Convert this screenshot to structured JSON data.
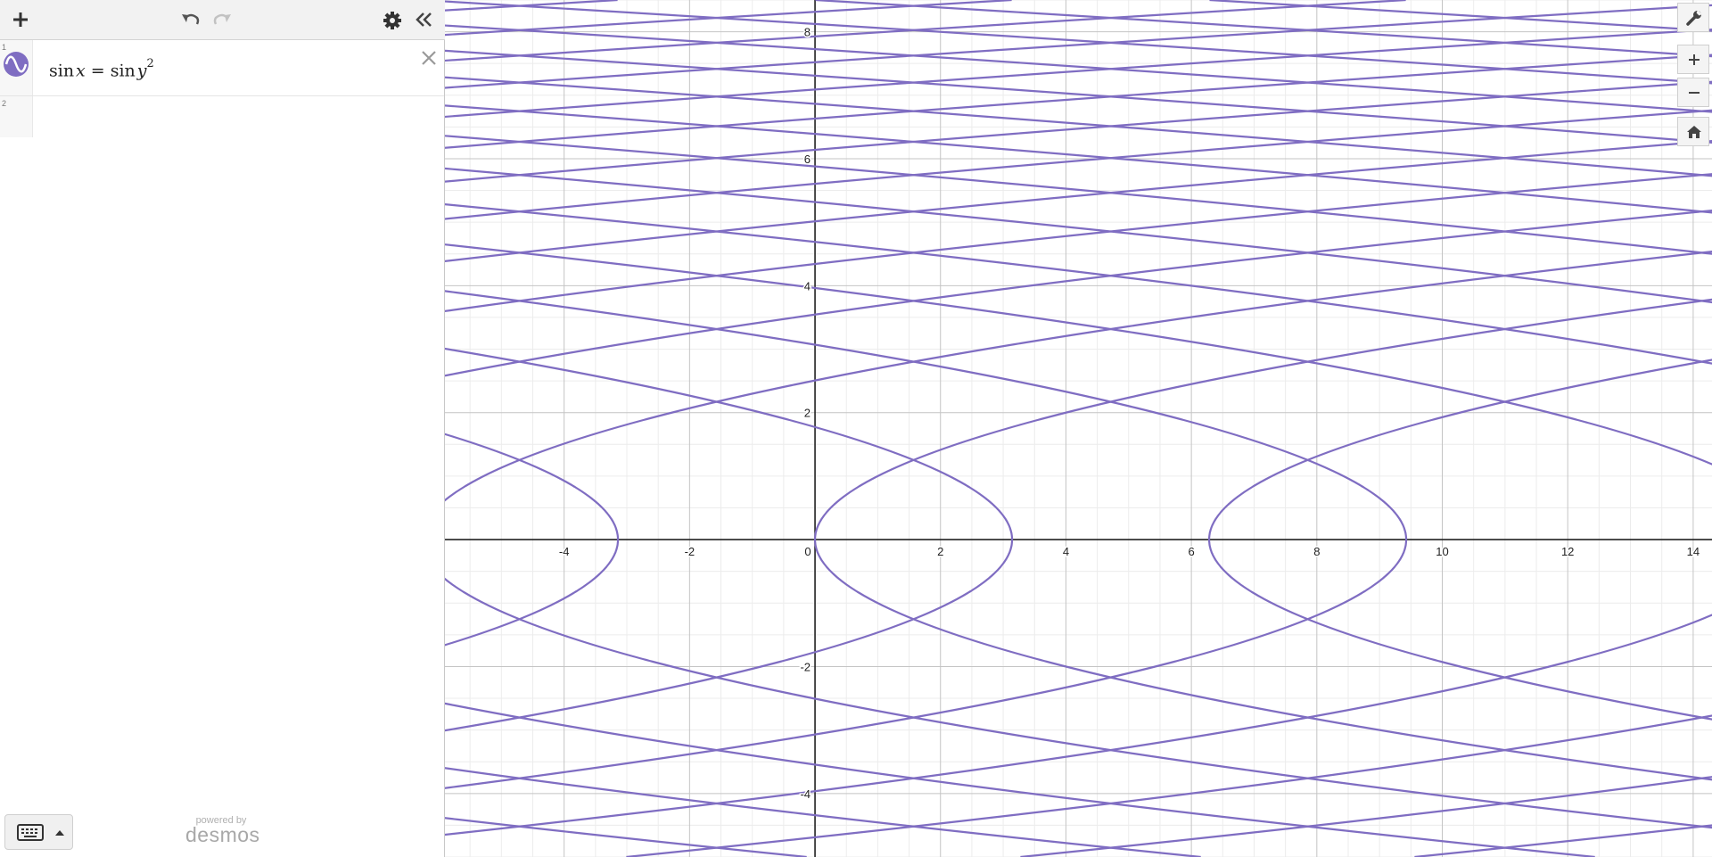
{
  "colors": {
    "curve": "#7f6dc2",
    "axis": "#222222",
    "grid_major": "#c4c4c4",
    "grid_minor": "#ececec",
    "toolbar_bg": "#f2f2f2"
  },
  "toolbar": {
    "add_icon": "plus-icon",
    "undo_icon": "undo-icon",
    "redo_icon": "redo-icon",
    "settings_icon": "gear-icon",
    "collapse_icon": "double-chevron-left-icon"
  },
  "expressions": [
    {
      "index": "1",
      "lhs_func": "sin",
      "lhs_var": "x",
      "equals": "=",
      "rhs_func": "sin",
      "rhs_var": "y",
      "rhs_exponent": "2",
      "color": "#7f6dc2"
    },
    {
      "index": "2"
    }
  ],
  "branding": {
    "powered_by": "powered by",
    "name": "desmos"
  },
  "right_controls": {
    "wrench_icon": "wrench-icon",
    "zoom_in_icon": "plus-icon",
    "zoom_out_icon": "minus-icon",
    "home_icon": "home-icon"
  },
  "chart_data": {
    "type": "line",
    "equation": "sin x = sin y^2",
    "xlim": [
      -5.9,
      14.3
    ],
    "ylim": [
      -5.0,
      8.5
    ],
    "x_ticks": [
      "-4",
      "-2",
      "0",
      "2",
      "4",
      "6",
      "8",
      "10",
      "12",
      "14"
    ],
    "y_ticks": [
      "-4",
      "-2",
      "2",
      "4",
      "6",
      "8"
    ],
    "grid": true,
    "minor_grid": true
  }
}
